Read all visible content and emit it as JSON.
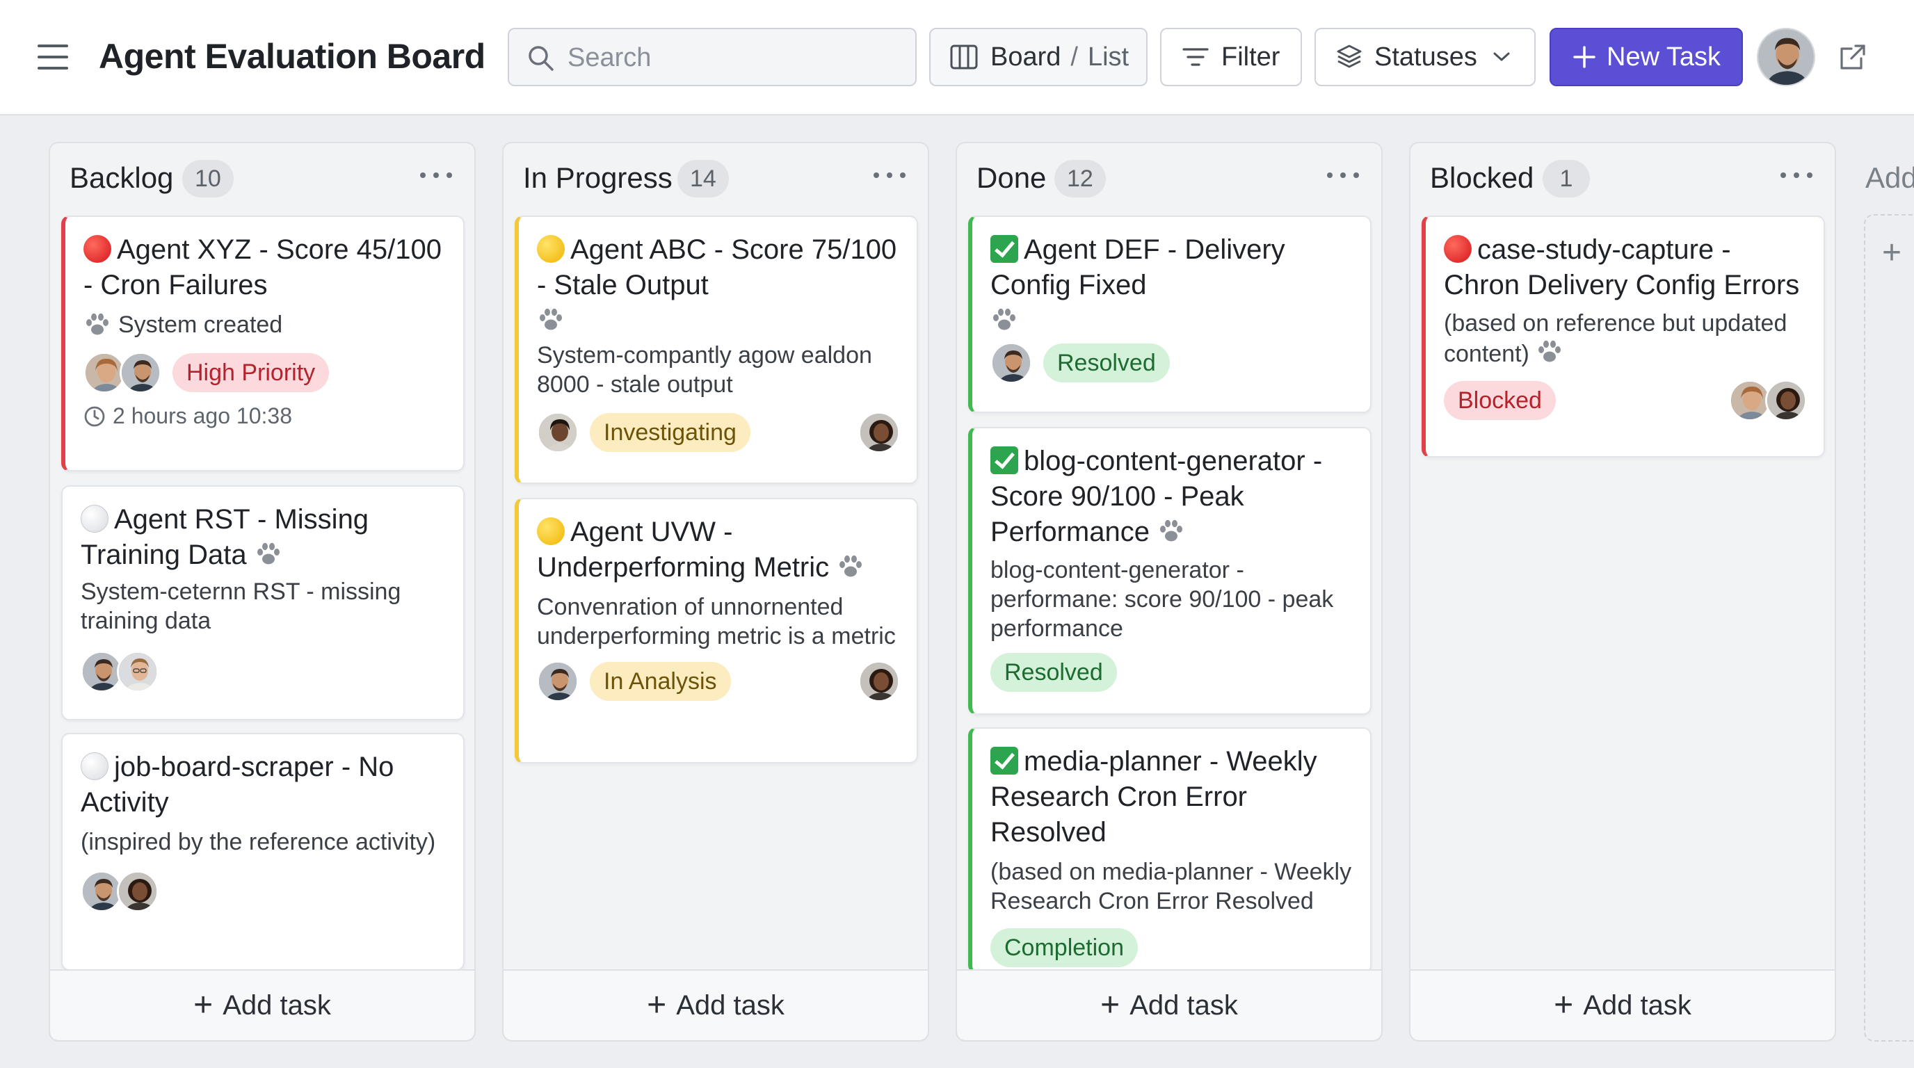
{
  "header": {
    "title": "Agent Evaluation Board",
    "search_placeholder": "Search",
    "view_board": "Board",
    "view_sep": "/",
    "view_list": "List",
    "filter": "Filter",
    "statuses": "Statuses",
    "new_task": "New Task",
    "accent_color": "#5b4fd6"
  },
  "add_column_label": "Add",
  "add_task_label": "Add task",
  "columns": [
    {
      "title": "Backlog",
      "count": "10",
      "cards": [
        {
          "status_icon": "red-circle",
          "title": "Agent XYZ - Score 45/100 - Cron Failures",
          "meta": "System created",
          "badge": "High Priority",
          "time": "2 hours ago 10:38"
        },
        {
          "status_icon": "white-circle",
          "title": "Agent RST - Missing Training Data",
          "desc": "System-ceternn RST - missing training data"
        },
        {
          "status_icon": "white-circle",
          "title": "job-board-scraper - No Activity",
          "desc": "(inspired by the reference activity)"
        }
      ]
    },
    {
      "title": "In Progress",
      "count": "14",
      "cards": [
        {
          "status_icon": "yellow-circle",
          "title": "Agent ABC - Score 75/100 - Stale Output",
          "desc": "System-compantly agow ealdon 8000 - stale output",
          "badge": "Investigating"
        },
        {
          "status_icon": "yellow-circle",
          "title": "Agent UVW - Underperforming Metric",
          "desc": "Convenration of unnornented underperforming metric is a metric",
          "badge": "In Analysis"
        }
      ]
    },
    {
      "title": "Done",
      "count": "12",
      "cards": [
        {
          "status_icon": "green-check",
          "title": "Agent DEF - Delivery Config Fixed",
          "badge": "Resolved"
        },
        {
          "status_icon": "green-check",
          "title": "blog-content-generator - Score 90/100 - Peak Performance",
          "desc": "blog-content-generator - performane: score 90/100 - peak performance",
          "badge": "Resolved"
        },
        {
          "status_icon": "green-check",
          "title": "media-planner - Weekly Research Cron Error Resolved",
          "desc": "(based on media-planner - Weekly Research Cron Error Resolved",
          "badge": "Completion"
        }
      ]
    },
    {
      "title": "Blocked",
      "count": "1",
      "cards": [
        {
          "status_icon": "red-circle",
          "title": "case-study-capture - Chron Delivery Config Errors",
          "desc": "(based on reference but updated content)",
          "badge": "Blocked"
        }
      ]
    }
  ]
}
